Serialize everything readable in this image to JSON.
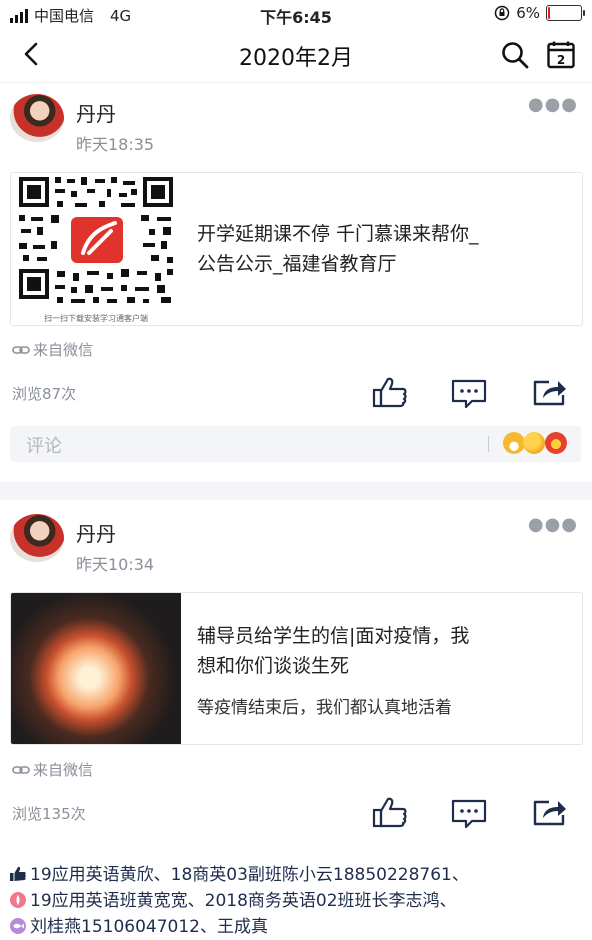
{
  "status_bar": {
    "carrier": "中国电信",
    "network": "4G",
    "time": "下午6:45",
    "battery": "6%",
    "battery_level": 0.06
  },
  "nav": {
    "title": "2020年2月"
  },
  "posts": [
    {
      "author": "丹丹",
      "time": "昨天18:35",
      "card_title": "开学延期课不停 千门慕课来帮你_公告公示_福建省教育厅",
      "card_title_line1": "开学延期课不停 千门慕课来帮你_",
      "card_title_line2": "公告公示_福建省教育厅",
      "qr_caption": "扫一扫下载安装学习通客户端",
      "source": "来自微信",
      "views": "浏览87次",
      "comment_placeholder": "评论"
    },
    {
      "author": "丹丹",
      "time": "昨天10:34",
      "card_title_line1": "辅导员给学生的信|面对疫情，我",
      "card_title_line2": "想和你们谈谈生死",
      "card_subtitle": "等疫情结束后，我们都认真地活着",
      "source": "来自微信",
      "views": "浏览135次"
    }
  ],
  "likes": {
    "line1": "19应用英语黄欣、18商英03副班陈小云18850228761、",
    "line2": "19应用英语班黄宽宽、2018商务英语02班班长李志鸿、",
    "line3": "刘桂燕15106047012、王成真"
  },
  "colors": {
    "accent": "#1f2d4d",
    "muted": "#8a8f99",
    "battery_low": "#e02020",
    "divider": "#f3f5f8"
  }
}
